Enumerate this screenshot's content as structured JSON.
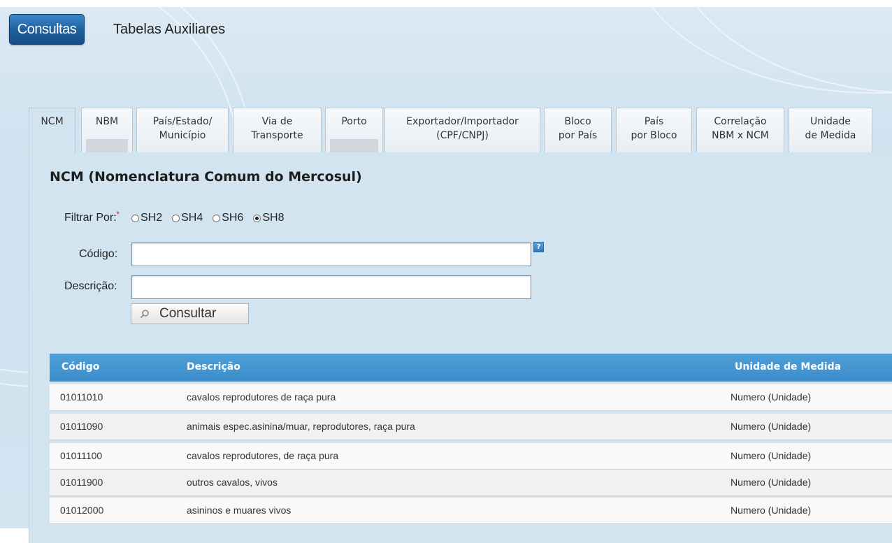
{
  "header": {
    "consultas_label": "Consultas",
    "tabelas_label": "Tabelas Auxiliares"
  },
  "tabs": [
    {
      "l1": "NCM",
      "l2": ""
    },
    {
      "l1": "NBM",
      "l2": ""
    },
    {
      "l1": "País/Estado/",
      "l2": "Município"
    },
    {
      "l1": "Via de",
      "l2": "Transporte"
    },
    {
      "l1": "Porto",
      "l2": ""
    },
    {
      "l1": "Exportador/Importador",
      "l2": "(CPF/CNPJ)"
    },
    {
      "l1": "Bloco",
      "l2": "por País"
    },
    {
      "l1": "País",
      "l2": "por Bloco"
    },
    {
      "l1": "Correlação",
      "l2": "NBM x NCM"
    },
    {
      "l1": "Unidade",
      "l2": "de Medida"
    }
  ],
  "form": {
    "title": "NCM (Nomenclatura Comum do Mercosul)",
    "filter_label": "Filtrar Por:",
    "required_mark": "*",
    "filter_options": [
      "SH2",
      "SH4",
      "SH6",
      "SH8"
    ],
    "filter_selected": "SH8",
    "codigo_label": "Código:",
    "codigo_value": "",
    "descricao_label": "Descrição:",
    "descricao_value": "",
    "help_glyph": "?",
    "consultar_label": "Consultar"
  },
  "table": {
    "headers": {
      "codigo": "Código",
      "descricao": "Descrição",
      "unidade": "Unidade de Medida"
    },
    "rows": [
      {
        "codigo": "01011010",
        "descricao": "cavalos reprodutores de raça pura",
        "unidade": "Numero (Unidade)"
      },
      {
        "codigo": "01011090",
        "descricao": "animais espec.asinina/muar, reprodutores, raça pura",
        "unidade": "Numero (Unidade)"
      },
      {
        "codigo": "01011100",
        "descricao": "cavalos reprodutores, de raça pura",
        "unidade": "Numero (Unidade)"
      },
      {
        "codigo": "01011900",
        "descricao": "outros cavalos, vivos",
        "unidade": "Numero (Unidade)"
      },
      {
        "codigo": "01012000",
        "descricao": "asininos e muares vivos",
        "unidade": "Numero (Unidade)"
      }
    ]
  },
  "colors": {
    "header_blue": "#3b8ccb",
    "button_blue": "#1e5f9e",
    "panel_bg": "#d3e4f1"
  }
}
